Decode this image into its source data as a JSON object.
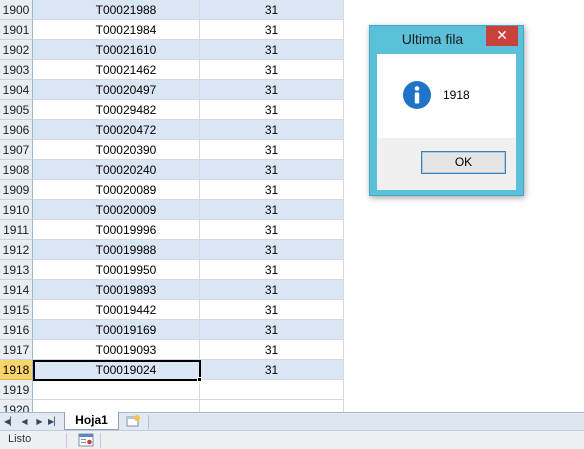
{
  "grid": {
    "rows": [
      {
        "num": "1900",
        "a": "T00021988",
        "b": "31"
      },
      {
        "num": "1901",
        "a": "T00021984",
        "b": "31"
      },
      {
        "num": "1902",
        "a": "T00021610",
        "b": "31"
      },
      {
        "num": "1903",
        "a": "T00021462",
        "b": "31"
      },
      {
        "num": "1904",
        "a": "T00020497",
        "b": "31"
      },
      {
        "num": "1905",
        "a": "T00029482",
        "b": "31"
      },
      {
        "num": "1906",
        "a": "T00020472",
        "b": "31"
      },
      {
        "num": "1907",
        "a": "T00020390",
        "b": "31"
      },
      {
        "num": "1908",
        "a": "T00020240",
        "b": "31"
      },
      {
        "num": "1909",
        "a": "T00020089",
        "b": "31"
      },
      {
        "num": "1910",
        "a": "T00020009",
        "b": "31"
      },
      {
        "num": "1911",
        "a": "T00019996",
        "b": "31"
      },
      {
        "num": "1912",
        "a": "T00019988",
        "b": "31"
      },
      {
        "num": "1913",
        "a": "T00019950",
        "b": "31"
      },
      {
        "num": "1914",
        "a": "T00019893",
        "b": "31"
      },
      {
        "num": "1915",
        "a": "T00019442",
        "b": "31"
      },
      {
        "num": "1916",
        "a": "T00019169",
        "b": "31"
      },
      {
        "num": "1917",
        "a": "T00019093",
        "b": "31"
      },
      {
        "num": "1918",
        "a": "T00019024",
        "b": "31"
      },
      {
        "num": "1919",
        "a": "",
        "b": ""
      },
      {
        "num": "1920",
        "a": "",
        "b": ""
      }
    ],
    "selected_row": "1918"
  },
  "tabs": {
    "sheet_name": "Hoja1",
    "nav_icons": [
      "first-sheet-icon",
      "prev-sheet-icon",
      "next-sheet-icon",
      "last-sheet-icon"
    ]
  },
  "status": {
    "text": "Listo"
  },
  "dialog": {
    "title": "Ultima fila",
    "message": "1918",
    "ok_label": "OK",
    "close_label": "✕",
    "icon": "info-icon"
  },
  "colors": {
    "dialog_frame": "#5bc0d9",
    "close_button": "#c8413a",
    "selected_row_header": "#f8d46b",
    "band_row": "#dbe6f4"
  }
}
